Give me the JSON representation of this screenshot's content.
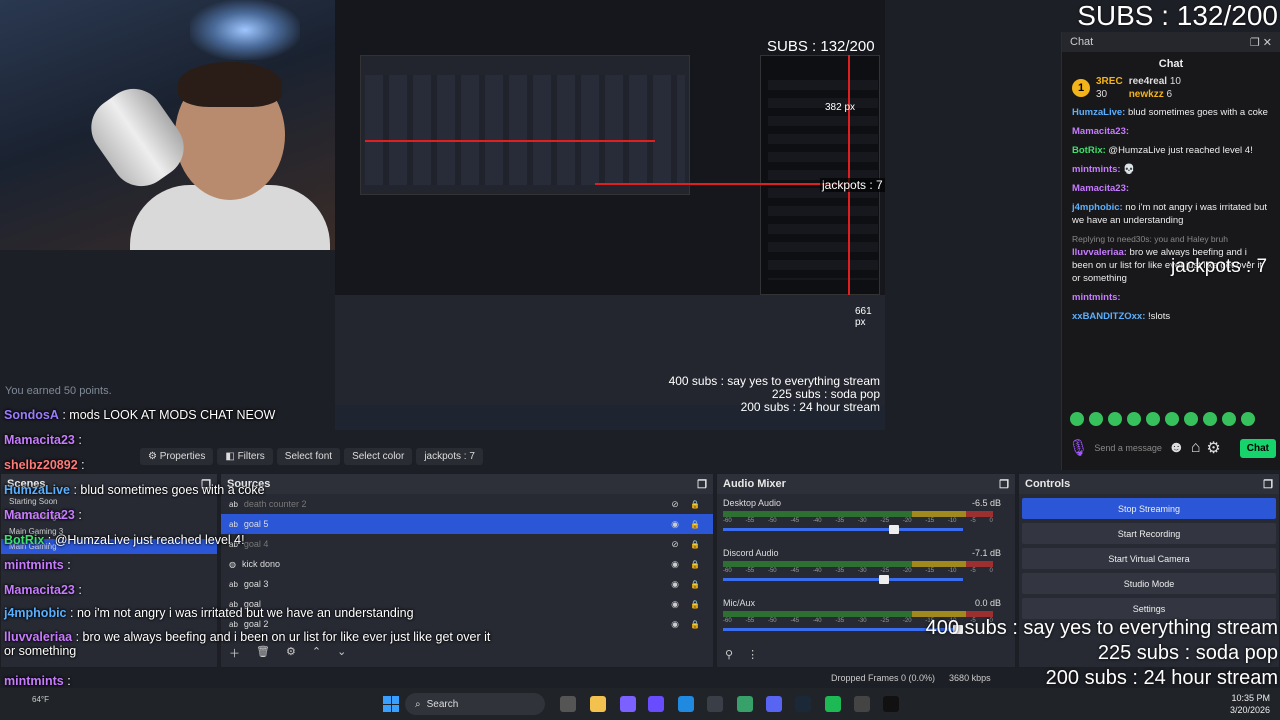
{
  "overlay": {
    "subs_top": "SUBS : 132/200",
    "jackpots": "jackpots : 7",
    "sub_goals": [
      "400 subs : say yes to everything stream",
      "225 subs : soda pop",
      "200 subs : 24 hour stream"
    ],
    "earned_points": "You earned 50 points.",
    "nested_subs": "SUBS : 132/200",
    "nested_px1": "382 px",
    "nested_px2": "661 px",
    "nested_jackpots": "jackpots : 7"
  },
  "chat_overlay": [
    {
      "user": "SondosA",
      "text": ": mods LOOK AT MODS CHAT NEOW",
      "color": "#9b7cff"
    },
    {
      "user": "Mamacita23",
      "text": ":",
      "color": "#c77cff"
    },
    {
      "user": "shelbz20892",
      "text": ":",
      "color": "#ff7a7a"
    },
    {
      "user": "HumzaLive",
      "text": ": blud sometimes goes with a coke",
      "color": "#5ab0ff"
    },
    {
      "user": "Mamacita23",
      "text": ":",
      "color": "#c77cff"
    },
    {
      "user": "BotRix",
      "text": ": @HumzaLive just reached level 4!",
      "color": "#3ee06a"
    },
    {
      "user": "mintmints",
      "text": ":",
      "color": "#c77cff"
    },
    {
      "user": "Mamacita23",
      "text": ":",
      "color": "#c77cff"
    },
    {
      "user": "j4mphobic",
      "text": ": no i'm not angry i was irritated but we have an understanding",
      "color": "#5ab0ff"
    },
    {
      "user": "lluvvaleriaa",
      "text": ": bro we always beefing and i been on ur list for like ever just like get over it or something",
      "color": "#c77cff"
    },
    {
      "user": "mintmints",
      "text": ":",
      "color": "#c77cff"
    },
    {
      "user": "xxBANDITZOxx",
      "text": ": !slots",
      "color": "#5ab0ff"
    }
  ],
  "chat_panel": {
    "dock_title": "Chat",
    "title": "Chat",
    "leaderboard": [
      {
        "name": "3REC",
        "points": "30"
      },
      {
        "name": "ree4real",
        "points": "10"
      },
      {
        "name": "newkzz",
        "points": "6"
      }
    ],
    "messages": [
      {
        "user": "HumzaLive:",
        "text": " blud sometimes goes with a coke",
        "color": "#5ab0ff"
      },
      {
        "user": "Mamacita23:",
        "text": "",
        "color": "#c77cff"
      },
      {
        "user": "BotRix:",
        "text": " @HumzaLive just reached level 4!",
        "color": "#3ee06a"
      },
      {
        "user": "mintmints:",
        "text": " 💀",
        "color": "#c77cff"
      },
      {
        "user": "Mamacita23:",
        "text": "",
        "color": "#c77cff"
      },
      {
        "user": "j4mphobic:",
        "text": " no i'm not angry i was irritated but we have an understanding",
        "color": "#5ab0ff"
      },
      {
        "user": "lluvvaleriaa:",
        "text": " bro we always beefing and i been on ur list for like ever just like get over it or something",
        "color": "#c77cff"
      },
      {
        "user": "mintmints:",
        "text": "",
        "color": "#c77cff"
      },
      {
        "user": "xxBANDITZOxx:",
        "text": " !slots",
        "color": "#5ab0ff"
      }
    ],
    "reply_hint": "Replying to need30s: you and Haley bruh",
    "input_placeholder": "Send a message",
    "send_label": "Chat"
  },
  "toolbar": {
    "properties": "Properties",
    "filters": "Filters",
    "select_font": "Select font",
    "select_color": "Select color",
    "current_source": "jackpots : 7"
  },
  "scenes": {
    "title": "Scenes",
    "items": [
      "Starting Soon",
      "Main Gaming 2",
      "Main Gaming 3",
      "Main Gaming"
    ]
  },
  "sources": {
    "title": "Sources",
    "items": [
      {
        "name": "death counter 2",
        "icon": "ab",
        "dim": true
      },
      {
        "name": "goal 5",
        "icon": "ab",
        "selected": true
      },
      {
        "name": "goal 4",
        "icon": "ab",
        "dim": true
      },
      {
        "name": "kick dono",
        "icon": "globe"
      },
      {
        "name": "goal 3",
        "icon": "ab"
      },
      {
        "name": "goal",
        "icon": "ab"
      },
      {
        "name": "goal 2",
        "icon": "ab"
      }
    ]
  },
  "mixer": {
    "title": "Audio Mixer",
    "ticks": [
      "-60",
      "-55",
      "-50",
      "-45",
      "-40",
      "-35",
      "-30",
      "-25",
      "-20",
      "-15",
      "-10",
      "-5",
      "0"
    ],
    "channels": [
      {
        "name": "Desktop Audio",
        "db": "-6.5 dB",
        "level": 0.72
      },
      {
        "name": "Discord Audio",
        "db": "-7.1 dB",
        "level": 0.68
      },
      {
        "name": "Mic/Aux",
        "db": "0.0 dB",
        "level": 1.0
      }
    ]
  },
  "controls": {
    "title": "Controls",
    "buttons": [
      "Stop Streaming",
      "Start Recording",
      "Start Virtual Camera",
      "Studio Mode",
      "Settings"
    ]
  },
  "status": {
    "dropped": "Dropped Frames 0 (0.0%)",
    "kbps": "3680 kbps"
  },
  "taskbar": {
    "search": "Search",
    "time": "10:35 PM",
    "date": "3/20/2026",
    "weather": "64°F"
  }
}
